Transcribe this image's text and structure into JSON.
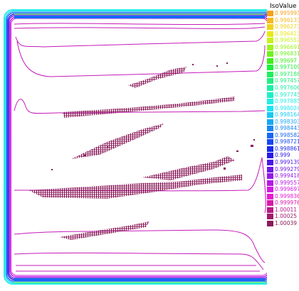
{
  "chart_data": {
    "type": "contour",
    "legend": {
      "title": "IsoValue",
      "placement": "right",
      "entries": [
        {
          "label": "0.995993",
          "color": "#f7a01c"
        },
        {
          "label": "0.996133",
          "color": "#f7b81c"
        },
        {
          "label": "0.996273",
          "color": "#f2d21b"
        },
        {
          "label": "0.996413",
          "color": "#e8ea1a"
        },
        {
          "label": "0.996552",
          "color": "#c8f21a"
        },
        {
          "label": "0.996691",
          "color": "#9cf51c"
        },
        {
          "label": "0.996831",
          "color": "#6ef21f"
        },
        {
          "label": "0.99697",
          "color": "#3ef01c"
        },
        {
          "label": "0.997109",
          "color": "#1df03a"
        },
        {
          "label": "0.997188",
          "color": "#1cf05e"
        },
        {
          "label": "0.997457",
          "color": "#1cf082"
        },
        {
          "label": "0.997606",
          "color": "#1cf0a6"
        },
        {
          "label": "0.997745",
          "color": "#1cf0c8"
        },
        {
          "label": "0.997885",
          "color": "#1ef0e6"
        },
        {
          "label": "0.998024",
          "color": "#1ce6f5"
        },
        {
          "label": "0.998164",
          "color": "#1ac8f5"
        },
        {
          "label": "0.998303",
          "color": "#18a8f5"
        },
        {
          "label": "0.998443",
          "color": "#1888f5"
        },
        {
          "label": "0.998582",
          "color": "#1868f5"
        },
        {
          "label": "0.998721",
          "color": "#1848f2"
        },
        {
          "label": "0.998861",
          "color": "#1a28ee"
        },
        {
          "label": "0.999",
          "color": "#2a1ae8"
        },
        {
          "label": "0.999139",
          "color": "#4c1ae6"
        },
        {
          "label": "0.999279",
          "color": "#701ae6"
        },
        {
          "label": "0.999418",
          "color": "#941ae6"
        },
        {
          "label": "0.999557",
          "color": "#b61ae6"
        },
        {
          "label": "0.999697",
          "color": "#d41ae2"
        },
        {
          "label": "0.999836",
          "color": "#e81ad2"
        },
        {
          "label": "0.999976",
          "color": "#d81aa8"
        },
        {
          "label": "1.00011",
          "color": "#b81a86"
        },
        {
          "label": "1.00025",
          "color": "#a01a6c"
        },
        {
          "label": "1.00039",
          "color": "#8a1a58"
        }
      ]
    },
    "grid": false
  }
}
